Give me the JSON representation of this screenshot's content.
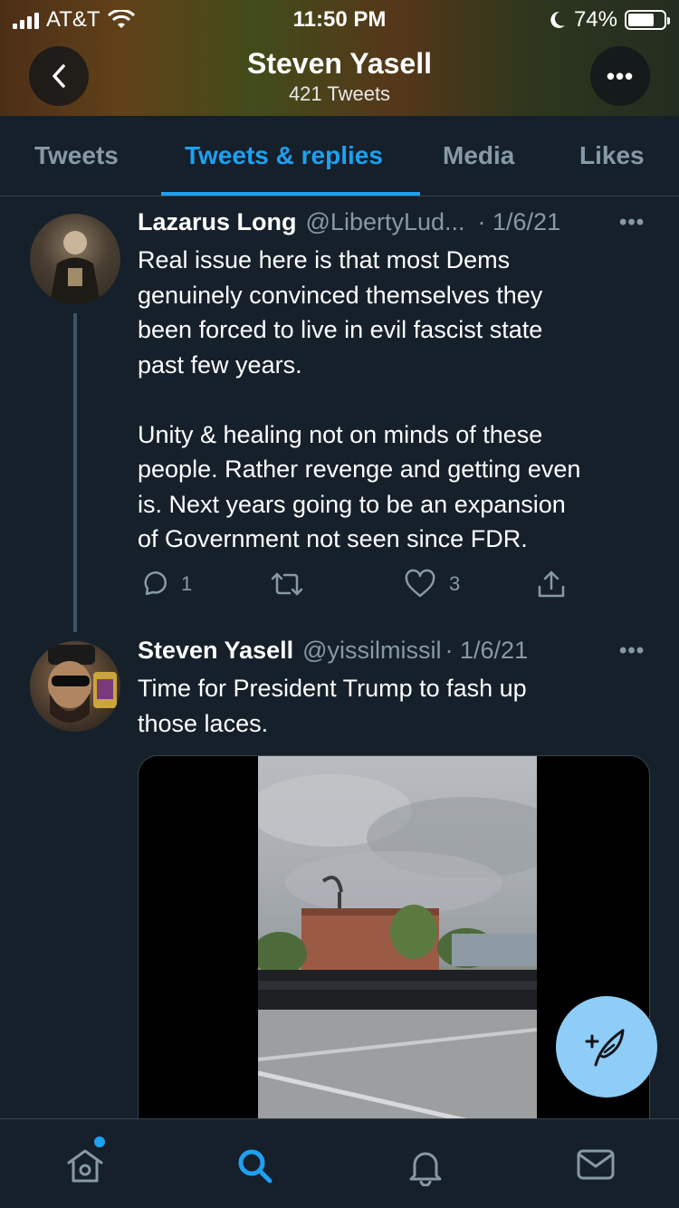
{
  "status": {
    "carrier": "AT&T",
    "time": "11:50 PM",
    "battery": "74%",
    "battery_level": 0.74
  },
  "header": {
    "title": "Steven Yasell",
    "subtitle": "421 Tweets"
  },
  "tabs": [
    {
      "label": "Tweets",
      "active": false
    },
    {
      "label": "Tweets & replies",
      "active": true
    },
    {
      "label": "Media",
      "active": false
    },
    {
      "label": "Likes",
      "active": false
    }
  ],
  "tweets": [
    {
      "name": "Lazarus Long",
      "handle": "@LibertyLud...",
      "date": "· 1/6/21",
      "text": "Real issue here is that most Dems\ngenuinely convinced themselves they\nbeen forced to live in evil fascist state\npast few years.\n\nUnity & healing not on minds of these\npeople. Rather revenge and getting even\nis. Next years going to be an expansion\nof Government not seen since FDR.",
      "reply_count": "1",
      "retweet_count": "",
      "like_count": "3"
    },
    {
      "name": "Steven Yasell",
      "handle": "@yissilmissil",
      "date": "· 1/6/21",
      "text": "Time for President Trump to fash up\nthose laces."
    }
  ],
  "colors": {
    "background": "#15202b",
    "accent": "#1da1f2",
    "muted": "#8899a6",
    "fab": "#8ecdf7"
  },
  "icons": {
    "back": "chevron-left-icon",
    "more": "more-horizontal-icon",
    "reply": "reply-icon",
    "retweet": "retweet-icon",
    "like": "heart-icon",
    "share": "share-icon",
    "compose": "compose-tweet-icon",
    "home": "home-icon",
    "search": "search-icon",
    "notifications": "bell-icon",
    "messages": "mail-icon"
  }
}
